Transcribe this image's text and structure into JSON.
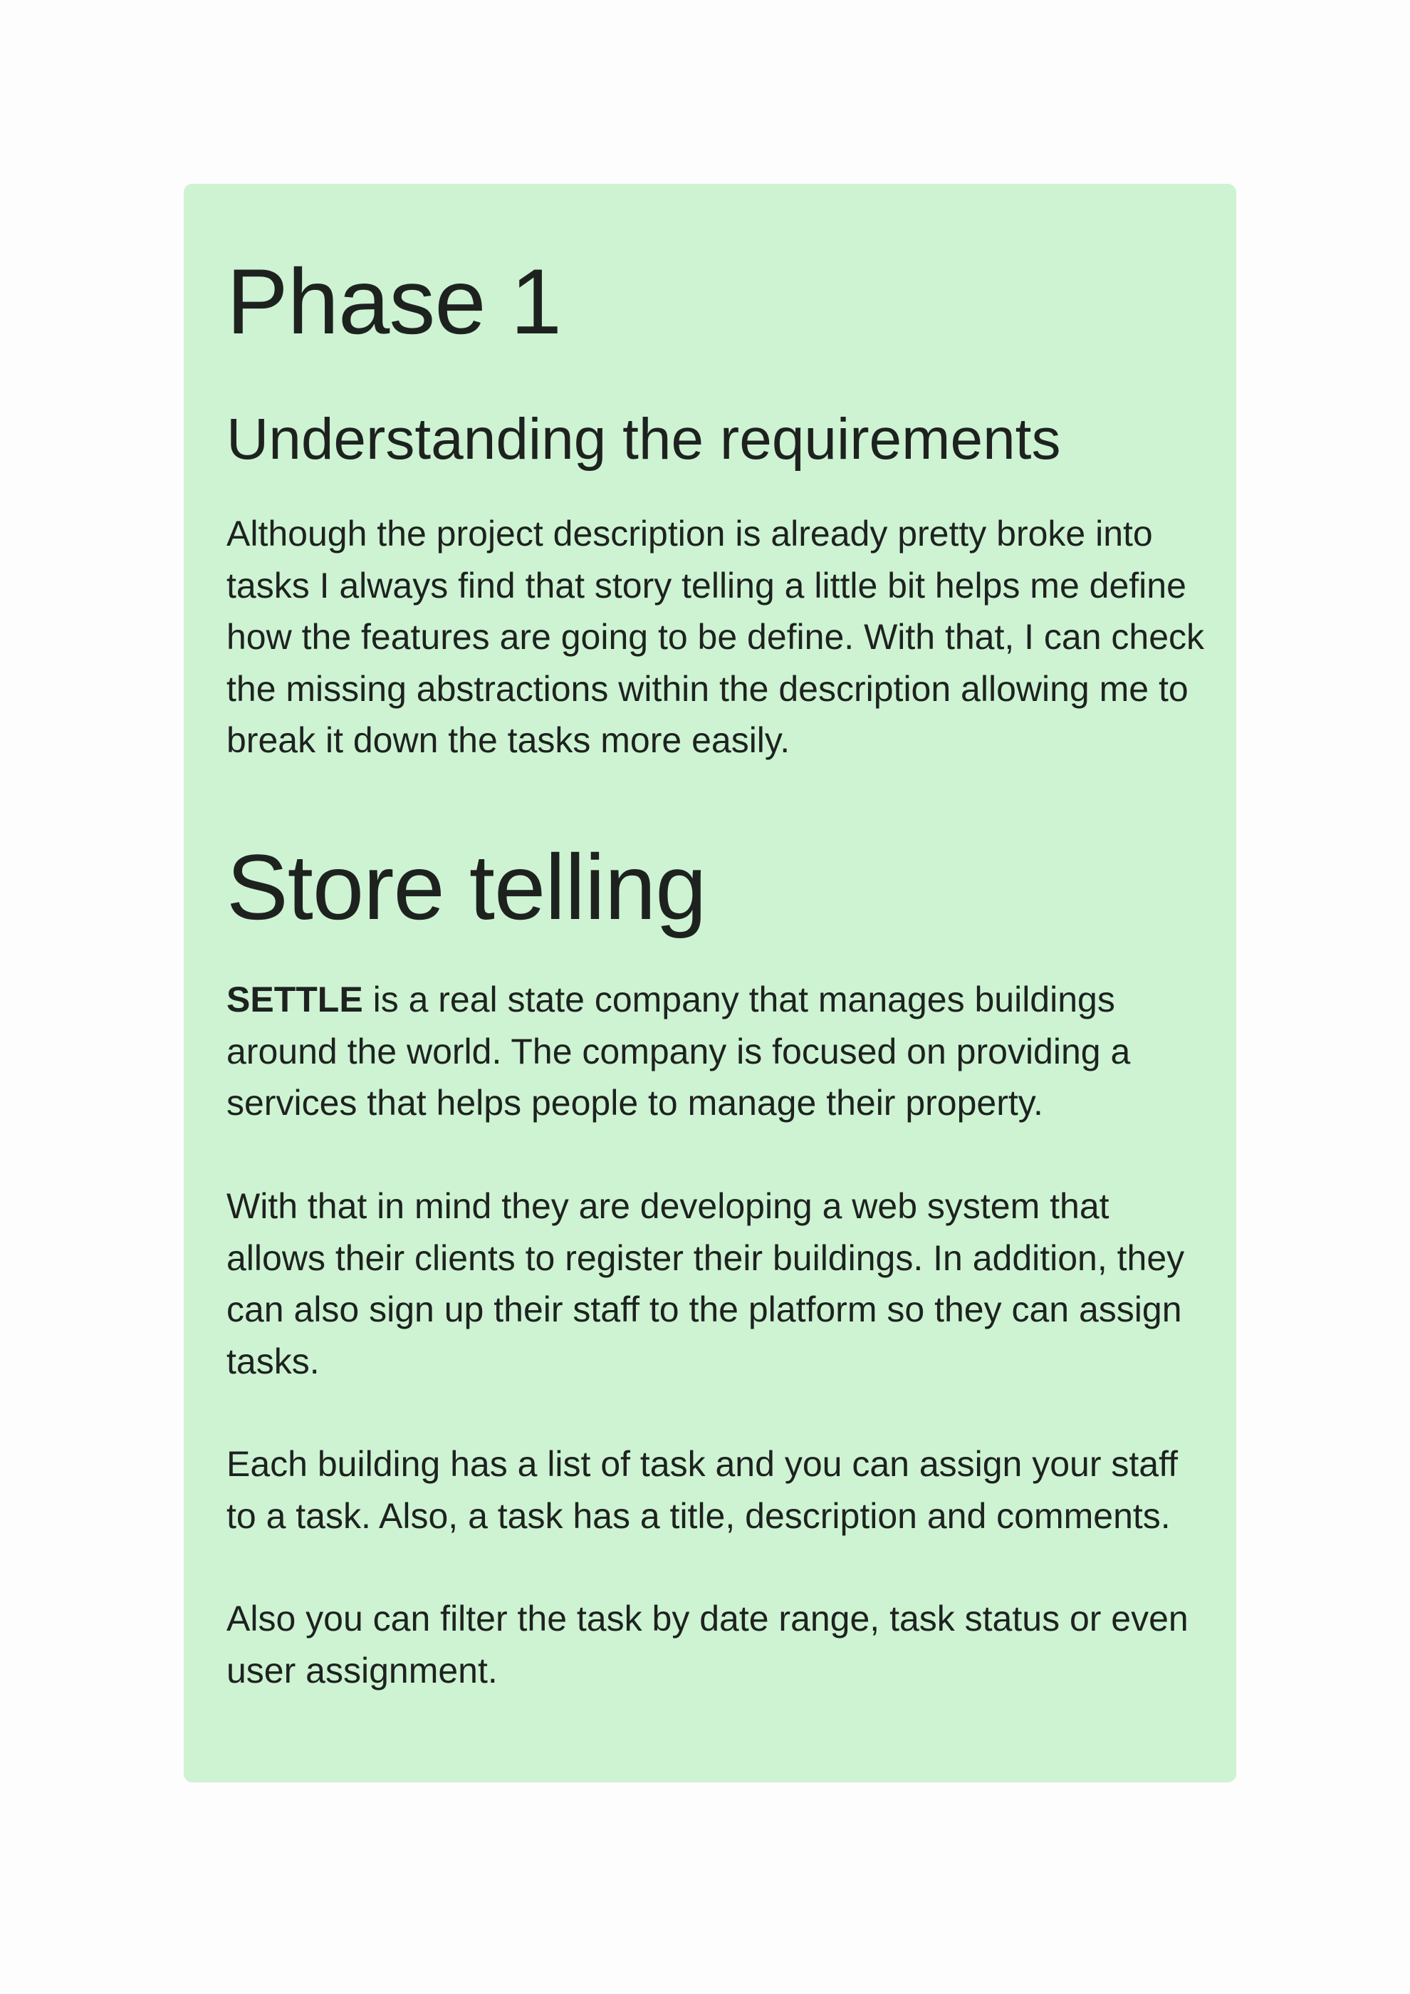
{
  "phase": {
    "title": "Phase 1",
    "subtitle": "Understanding the requirements",
    "intro": "Although the project description is already pretty broke into tasks I always find that story telling a little bit helps me define how the features are going to be define. With that, I can check the missing abstractions within the description allowing me to break it down the tasks more easily."
  },
  "story": {
    "title": "Store telling",
    "p1_brand": "SETTLE",
    "p1_rest": " is a real state company that manages buildings around the world. The company is  focused on providing a services that helps people to manage their property.",
    "p2": "With that in mind they are developing a web system that allows their clients to register their buildings. In addition, they can also sign up their staff to the platform so they can assign tasks.",
    "p3": "Each building has a list of task and you can assign your staff to a task. Also, a task has a title, description and comments.",
    "p4": "Also you can filter the task by date range, task status or even user assignment."
  },
  "colors": {
    "card_background": "#cdf3d3",
    "text": "#1e221f",
    "page_background": "#fdfdfd"
  }
}
